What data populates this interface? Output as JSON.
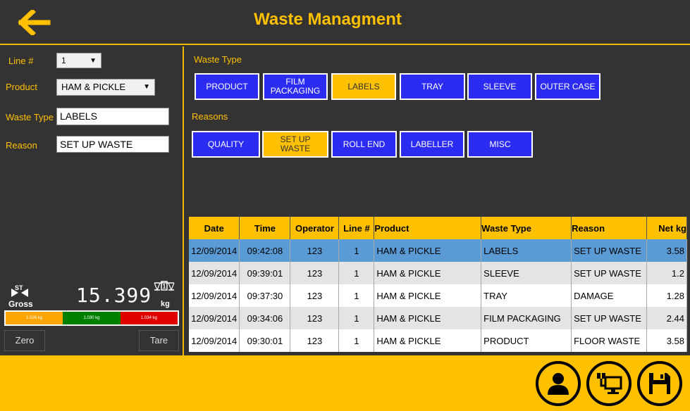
{
  "header": {
    "title": "Waste Managment"
  },
  "form": {
    "line_label": "Line #",
    "line_value": "1",
    "product_label": "Product",
    "product_value": "HAM & PICKLE",
    "waste_type_label": "Waste Type",
    "waste_type_value": "LABELS",
    "reason_label": "Reason",
    "reason_value": "SET UP WASTE"
  },
  "scale": {
    "st_label": "ST",
    "gross_label": "Gross",
    "weight": "15.399",
    "unit": "kg",
    "bar_labels": [
      "1.026 kg",
      "1.030 kg",
      "1.034 kg"
    ],
    "bar_colors": [
      "#ffa500",
      "#008000",
      "#e00000"
    ],
    "zero_label": "Zero",
    "tare_label": "Tare"
  },
  "waste_types": {
    "label": "Waste Type",
    "items": [
      {
        "label": "PRODUCT",
        "selected": false
      },
      {
        "label": "FILM PACKAGING",
        "selected": false
      },
      {
        "label": "LABELS",
        "selected": true
      },
      {
        "label": "TRAY",
        "selected": false
      },
      {
        "label": "SLEEVE",
        "selected": false
      },
      {
        "label": "OUTER CASE",
        "selected": false
      }
    ]
  },
  "reasons": {
    "label": "Reasons",
    "items": [
      {
        "label": "QUALITY",
        "selected": false
      },
      {
        "label": "SET UP WASTE",
        "selected": true
      },
      {
        "label": "ROLL END",
        "selected": false
      },
      {
        "label": "LABELLER",
        "selected": false
      },
      {
        "label": "MISC",
        "selected": false
      }
    ]
  },
  "table": {
    "headers": [
      "Date",
      "Time",
      "Operator",
      "Line #",
      "Product",
      "Waste Type",
      "Reason",
      "Net kg"
    ],
    "rows": [
      [
        "12/09/2014",
        "09:42:08",
        "123",
        "1",
        "HAM & PICKLE",
        "LABELS",
        "SET UP WASTE",
        "3.58"
      ],
      [
        "12/09/2014",
        "09:39:01",
        "123",
        "1",
        "HAM & PICKLE",
        "SLEEVE",
        "SET UP WASTE",
        "1.2"
      ],
      [
        "12/09/2014",
        "09:37:30",
        "123",
        "1",
        "HAM & PICKLE",
        "TRAY",
        "DAMAGE",
        "1.28"
      ],
      [
        "12/09/2014",
        "09:34:06",
        "123",
        "1",
        "HAM & PICKLE",
        "FILM PACKAGING",
        "SET UP WASTE",
        "2.44"
      ],
      [
        "12/09/2014",
        "09:30:01",
        "123",
        "1",
        "HAM & PICKLE",
        "PRODUCT",
        "FLOOR WASTE",
        "3.58"
      ]
    ]
  },
  "colors": {
    "accent": "#ffc000",
    "tile_blue": "#2b2bf2",
    "background": "#333333",
    "selected_row": "#5b9bd5"
  },
  "footer": {
    "icons": [
      "user-icon",
      "network-terminal-icon",
      "save-icon"
    ]
  }
}
